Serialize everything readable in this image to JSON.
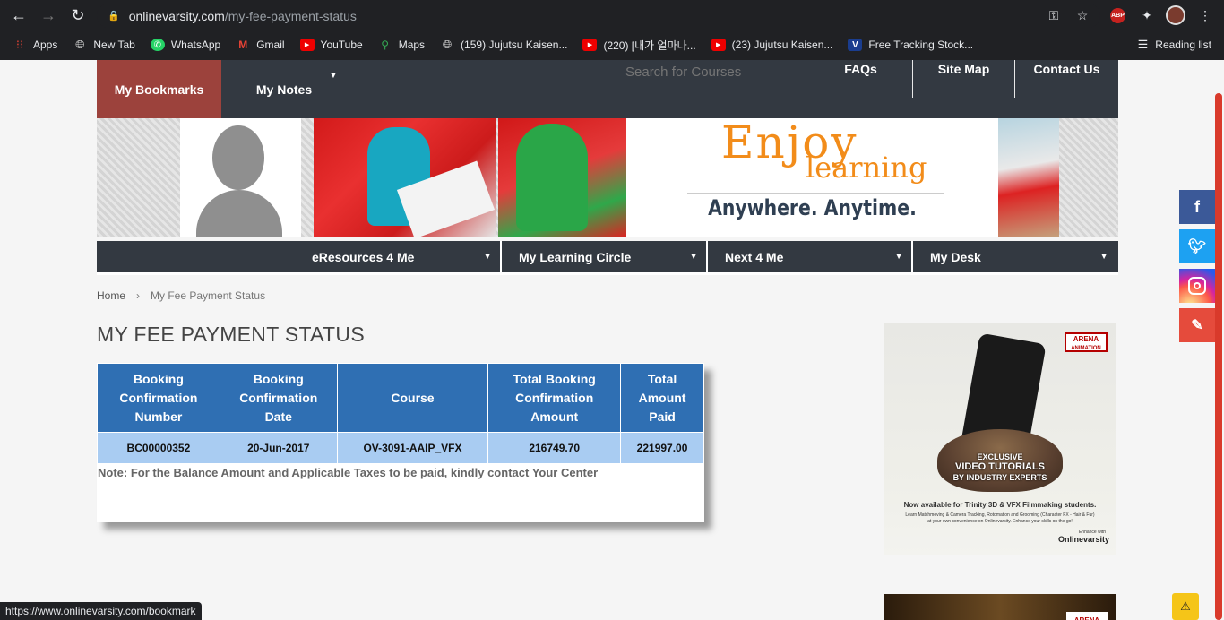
{
  "browser": {
    "url_host": "onlinevarsity.com",
    "url_path": "/my-fee-payment-status",
    "abp_label": "ABP",
    "bookmarks": [
      {
        "label": "Apps",
        "icon": "apps-grid-icon"
      },
      {
        "label": "New Tab",
        "icon": "globe-icon"
      },
      {
        "label": "WhatsApp",
        "icon": "whatsapp-icon"
      },
      {
        "label": "Gmail",
        "icon": "gmail-icon"
      },
      {
        "label": "YouTube",
        "icon": "youtube-icon"
      },
      {
        "label": "Maps",
        "icon": "maps-icon"
      },
      {
        "label": "(159) Jujutsu Kaisen...",
        "icon": "globe-icon"
      },
      {
        "label": "(220) [내가 얼마나...",
        "icon": "youtube-icon"
      },
      {
        "label": "(23) Jujutsu Kaisen...",
        "icon": "youtube-icon"
      },
      {
        "label": "Free Tracking Stock...",
        "icon": "v-logo-icon"
      }
    ],
    "reading_list": "Reading list",
    "status_url": "https://www.onlinevarsity.com/bookmark"
  },
  "topnav": {
    "bookmarks": "My Bookmarks",
    "notes": "My Notes",
    "search_placeholder": "Search for Courses",
    "faqs": "FAQs",
    "sitemap": "Site Map",
    "contact": "Contact Us"
  },
  "banner": {
    "enjoy": "Enjoy",
    "learning": "learning",
    "tagline": "Anywhere. Anytime."
  },
  "secnav": {
    "items": [
      "eResources 4 Me",
      "My Learning Circle",
      "Next 4 Me",
      "My Desk"
    ]
  },
  "breadcrumb": {
    "home": "Home",
    "sep": "›",
    "current": "My Fee Payment Status"
  },
  "page": {
    "title": "MY FEE PAYMENT STATUS"
  },
  "table": {
    "headers": [
      [
        "Booking",
        "Confirmation",
        "Number"
      ],
      [
        "Booking",
        "Confirmation",
        "Date"
      ],
      [
        "Course"
      ],
      [
        "Total Booking",
        "Confirmation",
        "Amount"
      ],
      [
        "Total",
        "Amount",
        "Paid"
      ]
    ],
    "row": [
      "BC00000352",
      "20-Jun-2017",
      "OV-3091-AAIP_VFX",
      "216749.70",
      "221997.00"
    ],
    "note": "Note: For the Balance Amount and Applicable Taxes to be paid, kindly contact Your Center"
  },
  "ad": {
    "badge_top": "ARENA",
    "badge_bottom": "ANIMATION",
    "headline1": "EXCLUSIVE",
    "headline2": "VIDEO TUTORIALS",
    "headline3": "BY INDUSTRY EXPERTS",
    "available": "Now available for Trinity 3D & VFX Filmmaking students.",
    "sub": "Learn Matchmoving & Camera Tracking, Rotomation and Grooming (Character FX - Hair & Fur)",
    "sub2": "at your own convenience on Onlinevarsity. Enhance your skills on the go!",
    "enhance": "Enhance with",
    "logo": "Onlinevarsity",
    "ad2_badge": "ARENA"
  },
  "colors": {
    "nav_bg": "#333941",
    "bookmark_active": "#9c423c",
    "table_header": "#2f6fb3",
    "table_row": "#a9ccf2",
    "facebook": "#3b5998",
    "twitter": "#1da1f2",
    "instagram": "#c13584",
    "feedback": "#e54b3c"
  }
}
